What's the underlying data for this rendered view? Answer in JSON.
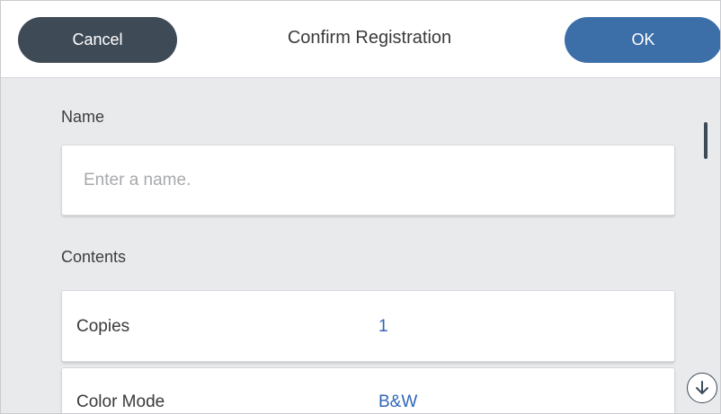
{
  "header": {
    "cancel_label": "Cancel",
    "title": "Confirm Registration",
    "ok_label": "OK"
  },
  "name_section": {
    "label": "Name",
    "input_value": "",
    "placeholder": "Enter a name."
  },
  "contents_section": {
    "label": "Contents",
    "rows": [
      {
        "label": "Copies",
        "value": "1"
      },
      {
        "label": "Color Mode",
        "value": "B&W"
      }
    ]
  },
  "icons": {
    "scroll_down": "arrow-down-circle-icon"
  },
  "colors": {
    "cancel_bg": "#3f4a57",
    "ok_bg": "#3c6ea8",
    "value_text": "#2f66b8",
    "page_bg": "#e9eaec"
  }
}
